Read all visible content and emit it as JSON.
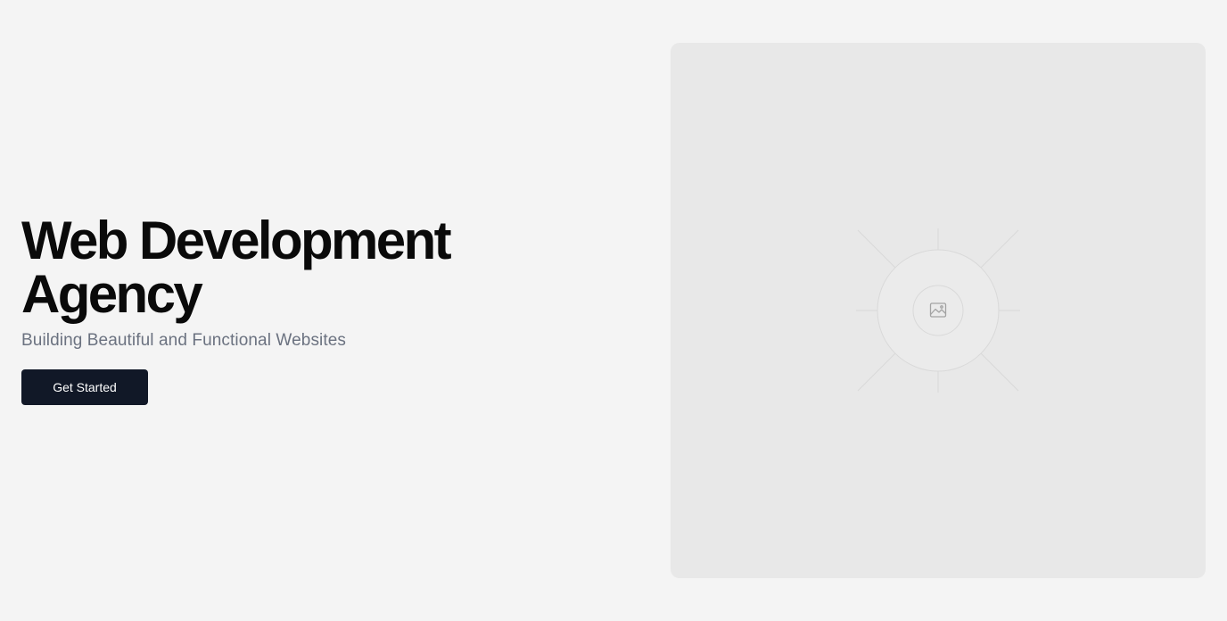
{
  "hero": {
    "title_line1": "Web Development",
    "title_line2": "Agency",
    "subtitle": "Building Beautiful and Functional Websites",
    "cta_label": "Get Started"
  },
  "image_placeholder": {
    "icon": "image-icon"
  },
  "colors": {
    "background": "#f4f4f4",
    "title": "#0a0a0a",
    "subtitle": "#6b7280",
    "button_bg": "#111827",
    "button_text": "#ffffff",
    "placeholder_bg": "#e8e8e8"
  }
}
